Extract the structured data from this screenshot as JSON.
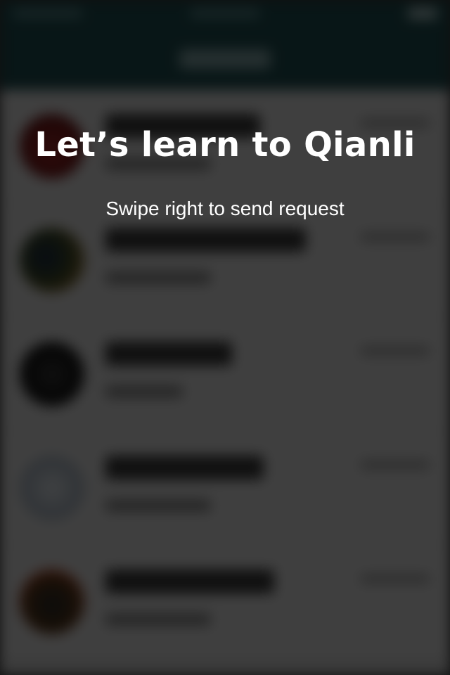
{
  "overlay": {
    "title": "Let’s learn to Qianli",
    "subtitle": "Swipe right to send request"
  },
  "background": {
    "contacts": [
      {
        "avatar_icon": "heart-avatar-icon",
        "color": "#8f1f1f"
      },
      {
        "avatar_icon": "group-photo-avatar-icon",
        "color": "#223a26"
      },
      {
        "avatar_icon": "silhouette-avatar-icon",
        "color": "#111111"
      },
      {
        "avatar_icon": "headphones-avatar-icon",
        "color": "#b5c0cb"
      },
      {
        "avatar_icon": "gauge-avatar-icon",
        "color": "#2b2b2b"
      }
    ]
  },
  "colors": {
    "header": "#1f4f52",
    "overlay": "rgba(0,0,0,0.72)"
  }
}
